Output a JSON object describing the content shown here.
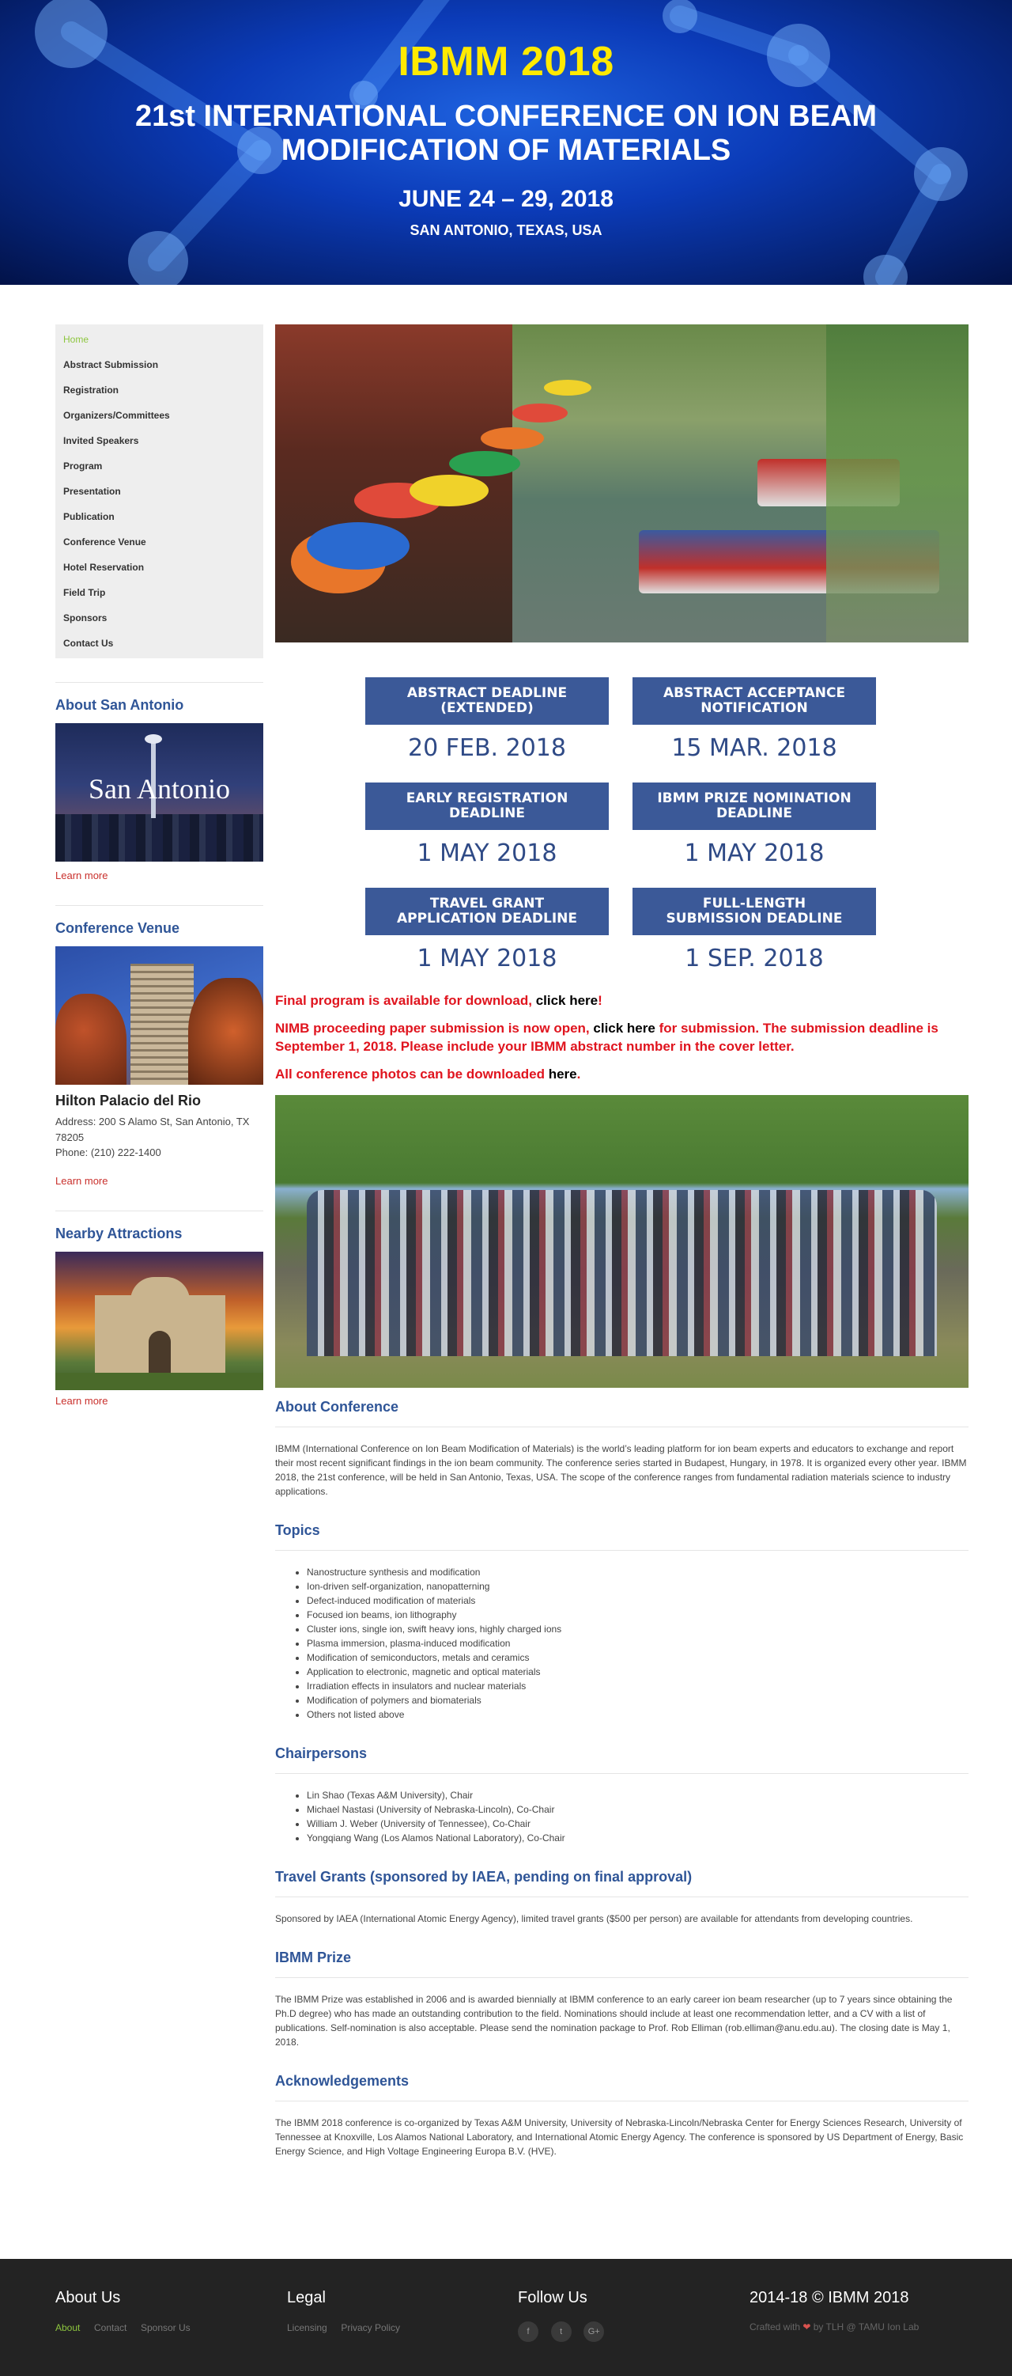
{
  "header": {
    "title": "IBMM 2018",
    "subtitle": "21st INTERNATIONAL CONFERENCE ON ION BEAM MODIFICATION OF MATERIALS",
    "dates": "JUNE 24 – 29, 2018",
    "location": "SAN ANTONIO, TEXAS, USA"
  },
  "nav": {
    "items": [
      {
        "label": "Home",
        "active": true
      },
      {
        "label": "Abstract Submission"
      },
      {
        "label": "Registration"
      },
      {
        "label": "Organizers/Committees"
      },
      {
        "label": "Invited Speakers"
      },
      {
        "label": "Program"
      },
      {
        "label": "Presentation"
      },
      {
        "label": "Publication"
      },
      {
        "label": "Conference Venue"
      },
      {
        "label": "Hotel Reservation"
      },
      {
        "label": "Field Trip"
      },
      {
        "label": "Sponsors"
      },
      {
        "label": "Contact Us"
      }
    ]
  },
  "sidebar": {
    "about": {
      "title": "About San Antonio",
      "image_caption": "San Antonio",
      "learn_more": "Learn more"
    },
    "venue": {
      "title": "Conference Venue",
      "name": "Hilton Palacio del Rio",
      "address": "Address: 200 S Alamo St, San Antonio, TX 78205",
      "phone": "Phone: (210) 222-1400",
      "learn_more": "Learn more"
    },
    "attractions": {
      "title": "Nearby Attractions",
      "learn_more": "Learn more"
    }
  },
  "deadlines": [
    {
      "label": "ABSTRACT DEADLINE\n(EXTENDED)",
      "date": "20 FEB. 2018"
    },
    {
      "label": "ABSTRACT ACCEPTANCE\nNOTIFICATION",
      "date": "15 MAR. 2018"
    },
    {
      "label": "EARLY REGISTRATION\nDEADLINE",
      "date": "1 MAY 2018"
    },
    {
      "label": "IBMM PRIZE NOMINATION\nDEADLINE",
      "date": "1 MAY 2018"
    },
    {
      "label": "TRAVEL GRANT\nAPPLICATION DEADLINE",
      "date": "1 MAY 2018"
    },
    {
      "label": "FULL-LENGTH\nSUBMISSION DEADLINE",
      "date": "1 SEP. 2018"
    }
  ],
  "notices": {
    "program_text": "Final program is available for download, ",
    "program_link": "click here",
    "program_end": "!",
    "nimb_text": "NIMB proceeding paper submission is now open, ",
    "nimb_link": "click here",
    "nimb_end": " for submission. The submission deadline is September 1, 2018. Please include your IBMM abstract number in the cover letter.",
    "photos_text": "All conference photos can be downloaded ",
    "photos_link": "here",
    "photos_end": "."
  },
  "sections": {
    "about": {
      "title": "About Conference",
      "text": "IBMM (International Conference on Ion Beam Modification of Materials) is the world’s leading platform for ion beam experts and educators to exchange and report their most recent significant findings in the ion beam community. The conference series started in Budapest, Hungary, in 1978. It is organized every other year. IBMM 2018, the 21st conference, will be held in San Antonio, Texas, USA. The scope of the conference ranges from fundamental radiation materials science to industry applications."
    },
    "topics": {
      "title": "Topics",
      "items": [
        "Nanostructure synthesis and modification",
        "Ion-driven self-organization, nanopatterning",
        "Defect-induced modification of materials",
        "Focused ion beams, ion lithography",
        "Cluster ions, single ion, swift heavy ions, highly charged ions",
        "Plasma immersion, plasma-induced modification",
        "Modification of semiconductors, metals and ceramics",
        "Application to electronic, magnetic and optical materials",
        "Irradiation effects in insulators and nuclear materials",
        "Modification of polymers and biomaterials",
        "Others not listed above"
      ]
    },
    "chairs": {
      "title": "Chairpersons",
      "items": [
        "Lin Shao (Texas A&M University), Chair",
        "Michael Nastasi (University of Nebraska-Lincoln), Co-Chair",
        "William J. Weber (University of Tennessee), Co-Chair",
        "Yongqiang Wang (Los Alamos National Laboratory), Co-Chair"
      ]
    },
    "travel": {
      "title": "Travel Grants (sponsored by IAEA, pending on final approval)",
      "text": "Sponsored by IAEA (International Atomic Energy Agency), limited travel grants ($500 per person) are available for attendants from developing countries."
    },
    "prize": {
      "title": "IBMM Prize",
      "text": "The IBMM Prize was established in 2006 and is awarded biennially at IBMM conference to an early career ion beam researcher (up to 7 years since obtaining the Ph.D degree) who has made an outstanding contribution to the field. Nominations should include at least one recommendation letter, and a CV with a list of publications. Self-nomination is also acceptable. Please send the nomination package to Prof. Rob Elliman (rob.elliman@anu.edu.au). The closing date is May 1, 2018."
    },
    "ack": {
      "title": "Acknowledgements",
      "text": "The IBMM 2018 conference is co-organized by Texas A&M University, University of Nebraska-Lincoln/Nebraska Center for Energy Sciences Research, University of Tennessee at Knoxville, Los Alamos National Laboratory, and International Atomic Energy Agency. The conference is sponsored by US Department of Energy, Basic Energy Science, and High Voltage Engineering Europa B.V. (HVE)."
    }
  },
  "footer": {
    "about": {
      "title": "About Us",
      "links": [
        "About",
        "Contact",
        "Sponsor Us"
      ]
    },
    "legal": {
      "title": "Legal",
      "links": [
        "Licensing",
        "Privacy Policy"
      ]
    },
    "follow": {
      "title": "Follow Us",
      "icons": [
        "facebook-icon",
        "twitter-icon",
        "google-plus-icon"
      ],
      "glyphs": [
        "f",
        "t",
        "G+"
      ]
    },
    "copyright": {
      "title": "2014-18 © IBMM 2018",
      "crafted_prefix": "Crafted with ",
      "crafted_suffix": " by TLH @ TAMU Ion Lab"
    }
  },
  "colors": {
    "accent_blue": "#3b5998",
    "title_blue": "#2f5597",
    "notice_red": "#e0141e",
    "nav_active": "#8dc63f",
    "hero_yellow": "#ffea00"
  }
}
